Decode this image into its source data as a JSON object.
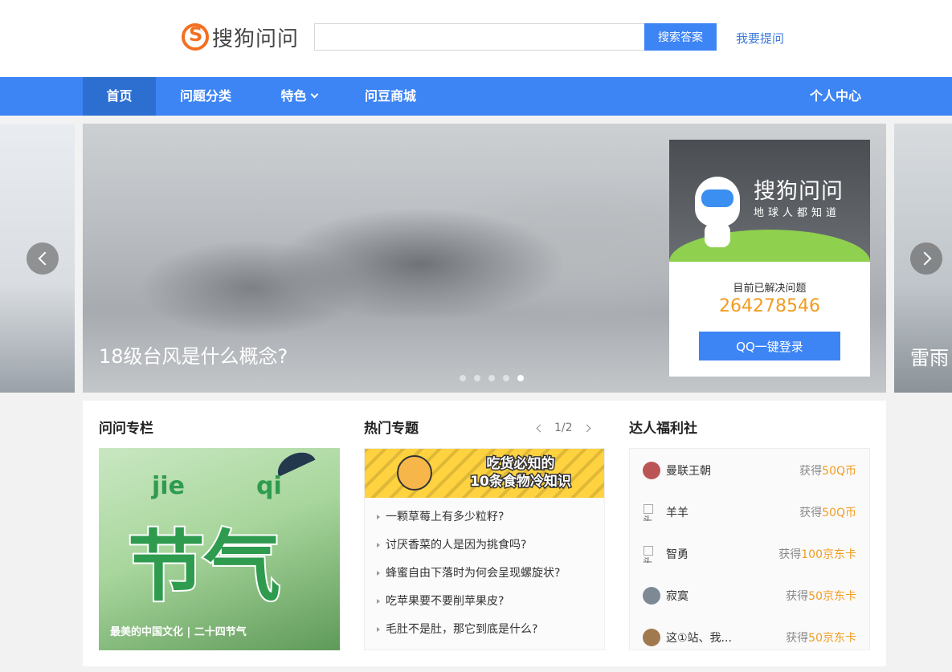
{
  "header": {
    "logo_text": "搜狗问问",
    "search_placeholder": "",
    "search_button": "搜索答案",
    "ask_link": "我要提问"
  },
  "nav": {
    "items": [
      "首页",
      "问题分类",
      "特色",
      "问豆商城"
    ],
    "personal": "个人中心"
  },
  "banner": {
    "caption": "18级台风是什么概念?",
    "next_caption": "雷雨",
    "dots_count": 5,
    "active_dot": 4
  },
  "login_card": {
    "brand": "搜狗问问",
    "slogan": "地球人都知道",
    "solved_label": "目前已解决问题",
    "solved_count": "264278546",
    "qq_button": "QQ一键登录"
  },
  "column": {
    "title": "问问专栏",
    "image_text_jie": "jie",
    "image_text_qi": "qi",
    "image_text_main": "节气",
    "caption": "最美的中国文化 | 二十四节气"
  },
  "topics": {
    "title": "热门专题",
    "pager": "1/2",
    "banner_line1": "吃货必知的",
    "banner_line2": "10条食物冷知识",
    "items": [
      "一颗草莓上有多少粒籽?",
      "讨厌香菜的人是因为挑食吗?",
      "蜂蜜自由下落时为何会呈现螺旋状?",
      "吃苹果要不要削苹果皮?",
      "毛肚不是肚，那它到底是什么?"
    ]
  },
  "daren": {
    "title": "达人福利社",
    "rows": [
      {
        "name": "曼联王朝",
        "prefix": "获得",
        "amount": "50Q币",
        "avatar_alt": ""
      },
      {
        "name": "羊羊",
        "prefix": "获得",
        "amount": "50Q币",
        "avatar_alt": "头"
      },
      {
        "name": "智勇",
        "prefix": "获得",
        "amount": "100京东卡",
        "avatar_alt": "头"
      },
      {
        "name": "寂寞",
        "prefix": "获得",
        "amount": "50京东卡",
        "avatar_alt": ""
      },
      {
        "name": "这①站、我...",
        "prefix": "获得",
        "amount": "50京东卡",
        "avatar_alt": ""
      }
    ]
  },
  "colors": {
    "brand_blue": "#3d84f5",
    "nav_active": "#2c6fd1",
    "accent_orange": "#f29c1f",
    "logo_orange": "#f37021"
  }
}
